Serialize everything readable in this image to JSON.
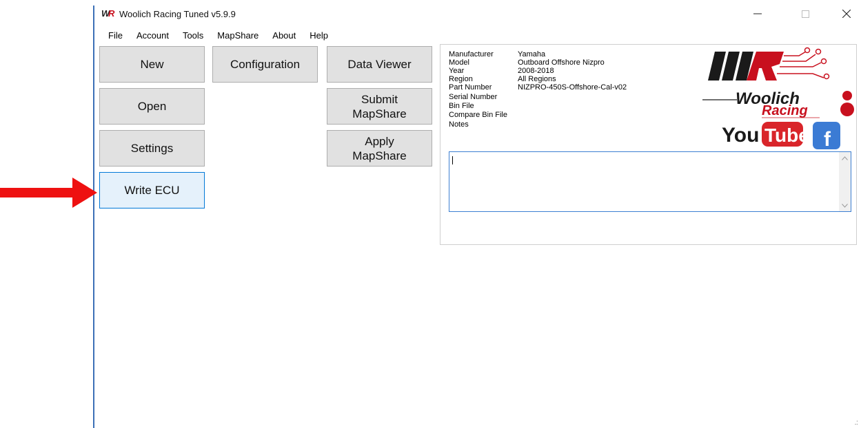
{
  "window": {
    "title": "Woolich Racing Tuned v5.9.9",
    "controls": {
      "minimize": "—",
      "maximize": "☐",
      "close": "✕"
    }
  },
  "menu": [
    "File",
    "Account",
    "Tools",
    "MapShare",
    "About",
    "Help"
  ],
  "buttons": {
    "new": "New",
    "open": "Open",
    "settings": "Settings",
    "write_ecu": "Write ECU",
    "configuration": "Configuration",
    "data_viewer": "Data Viewer",
    "submit_mapshare_line1": "Submit",
    "submit_mapshare_line2": "MapShare",
    "apply_mapshare_line1": "Apply",
    "apply_mapshare_line2": "MapShare"
  },
  "info": {
    "manufacturer_label": "Manufacturer",
    "manufacturer": "Yamaha",
    "model_label": "Model",
    "model": "Outboard Offshore Nizpro",
    "year_label": "Year",
    "year": "2008-2018",
    "region_label": "Region",
    "region": "All Regions",
    "part_number_label": "Part Number",
    "part_number": "NIZPRO-450S-Offshore-Cal-v02",
    "serial_number_label": "Serial Number",
    "serial_number": "",
    "bin_file_label": "Bin File",
    "bin_file": "",
    "compare_bin_file_label": "Compare Bin File",
    "compare_bin_file": "",
    "notes_label": "Notes",
    "notes": ""
  },
  "logo": {
    "brand_line1": "Woolich",
    "brand_line2": "Racing",
    "youtube_you": "You",
    "youtube_tube": "Tube",
    "facebook": "f"
  },
  "colors": {
    "accent": "#0078d7",
    "arrow": "#ee1111",
    "brand_red": "#c8101e",
    "youtube_red": "#d9252a",
    "facebook_blue": "#3b7bd4"
  }
}
